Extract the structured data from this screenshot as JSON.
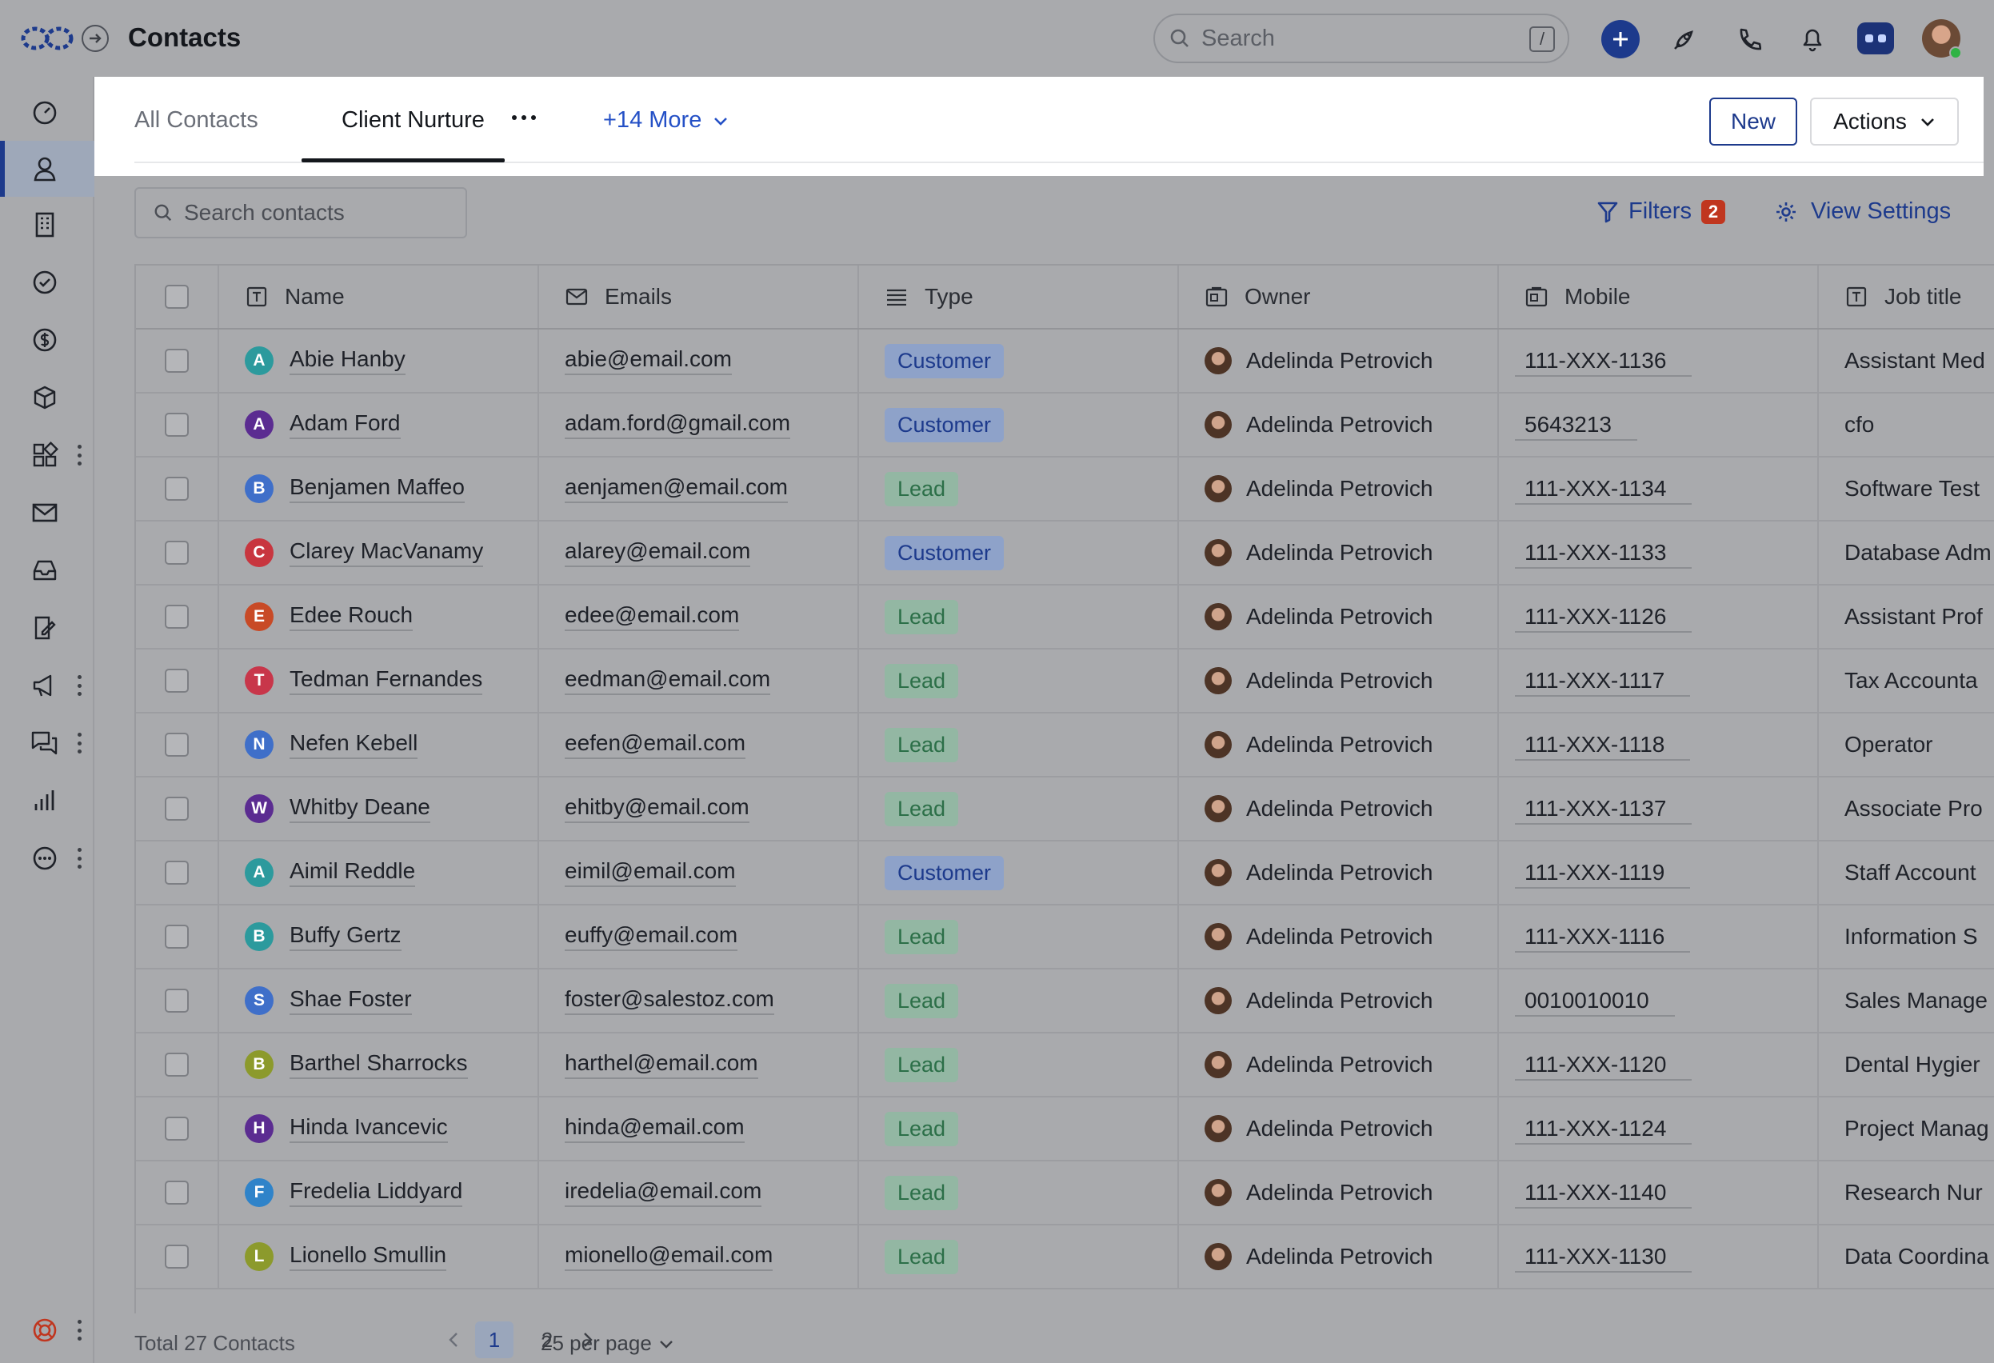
{
  "app": {
    "title": "Contacts"
  },
  "search": {
    "placeholder": "Search",
    "shortcut": "/"
  },
  "tabs": {
    "items": [
      {
        "label": "All Contacts"
      },
      {
        "label": "Client Nurture"
      }
    ],
    "more_label": "+14 More"
  },
  "buttons": {
    "new_label": "New",
    "actions_label": "Actions"
  },
  "toolbar": {
    "search_placeholder": "Search contacts",
    "filters_label": "Filters",
    "filters_count": "2",
    "view_settings_label": "View Settings"
  },
  "columns": [
    "Name",
    "Emails",
    "Type",
    "Owner",
    "Mobile",
    "Job title"
  ],
  "colors": {
    "accent": "#1d3a8c",
    "customer_pill": "#8ea2c9",
    "lead_pill": "#93b7a3",
    "badge": "#c0361f"
  },
  "rows": [
    {
      "initial": "A",
      "color": "#2c9a9d",
      "name": "Abie Hanby",
      "email": "abie@email.com",
      "type": "Customer",
      "owner": "Adelinda Petrovich",
      "mobile": "111-XXX-1136",
      "job": "Assistant Med"
    },
    {
      "initial": "A",
      "color": "#5b2c91",
      "name": "Adam Ford",
      "email": "adam.ford@gmail.com",
      "type": "Customer",
      "owner": "Adelinda Petrovich",
      "mobile": "5643213",
      "job": "cfo"
    },
    {
      "initial": "B",
      "color": "#3f6fc9",
      "name": "Benjamen Maffeo",
      "email": "aenjamen@email.com",
      "type": "Lead",
      "owner": "Adelinda Petrovich",
      "mobile": "111-XXX-1134",
      "job": "Software Test"
    },
    {
      "initial": "C",
      "color": "#c8363f",
      "name": "Clarey MacVanamy",
      "email": "alarey@email.com",
      "type": "Customer",
      "owner": "Adelinda Petrovich",
      "mobile": "111-XXX-1133",
      "job": "Database Adm"
    },
    {
      "initial": "E",
      "color": "#c84a26",
      "name": "Edee Rouch",
      "email": "edee@email.com",
      "type": "Lead",
      "owner": "Adelinda Petrovich",
      "mobile": "111-XXX-1126",
      "job": "Assistant Prof"
    },
    {
      "initial": "T",
      "color": "#c8364a",
      "name": "Tedman Fernandes",
      "email": "eedman@email.com",
      "type": "Lead",
      "owner": "Adelinda Petrovich",
      "mobile": "111-XXX-1117",
      "job": "Tax Accounta"
    },
    {
      "initial": "N",
      "color": "#3f6fc9",
      "name": "Nefen Kebell",
      "email": "eefen@email.com",
      "type": "Lead",
      "owner": "Adelinda Petrovich",
      "mobile": "111-XXX-1118",
      "job": "Operator"
    },
    {
      "initial": "W",
      "color": "#5b2c91",
      "name": "Whitby Deane",
      "email": "ehitby@email.com",
      "type": "Lead",
      "owner": "Adelinda Petrovich",
      "mobile": "111-XXX-1137",
      "job": "Associate Pro"
    },
    {
      "initial": "A",
      "color": "#2c9a9d",
      "name": "Aimil Reddle",
      "email": "eimil@email.com",
      "type": "Customer",
      "owner": "Adelinda Petrovich",
      "mobile": "111-XXX-1119",
      "job": "Staff Account"
    },
    {
      "initial": "B",
      "color": "#2c9a9d",
      "name": "Buffy Gertz",
      "email": "euffy@email.com",
      "type": "Lead",
      "owner": "Adelinda Petrovich",
      "mobile": "111-XXX-1116",
      "job": "Information S"
    },
    {
      "initial": "S",
      "color": "#3f6fc9",
      "name": "Shae Foster",
      "email": "foster@salestoz.com",
      "type": "Lead",
      "owner": "Adelinda Petrovich",
      "mobile": "0010010010",
      "job": "Sales Manage"
    },
    {
      "initial": "B",
      "color": "#8c9a2c",
      "name": "Barthel Sharrocks",
      "email": "harthel@email.com",
      "type": "Lead",
      "owner": "Adelinda Petrovich",
      "mobile": "111-XXX-1120",
      "job": "Dental Hygier"
    },
    {
      "initial": "H",
      "color": "#5b2c91",
      "name": "Hinda Ivancevic",
      "email": "hinda@email.com",
      "type": "Lead",
      "owner": "Adelinda Petrovich",
      "mobile": "111-XXX-1124",
      "job": "Project Manag"
    },
    {
      "initial": "F",
      "color": "#2f83c9",
      "name": "Fredelia Liddyard",
      "email": "iredelia@email.com",
      "type": "Lead",
      "owner": "Adelinda Petrovich",
      "mobile": "111-XXX-1140",
      "job": "Research Nur"
    },
    {
      "initial": "L",
      "color": "#8c9a2c",
      "name": "Lionello Smullin",
      "email": "mionello@email.com",
      "type": "Lead",
      "owner": "Adelinda Petrovich",
      "mobile": "111-XXX-1130",
      "job": "Data Coordina"
    }
  ],
  "footer": {
    "total_label": "Total 27 Contacts",
    "pages": [
      "1",
      "2"
    ],
    "current_page": "1",
    "per_page_label": "25 per page"
  }
}
